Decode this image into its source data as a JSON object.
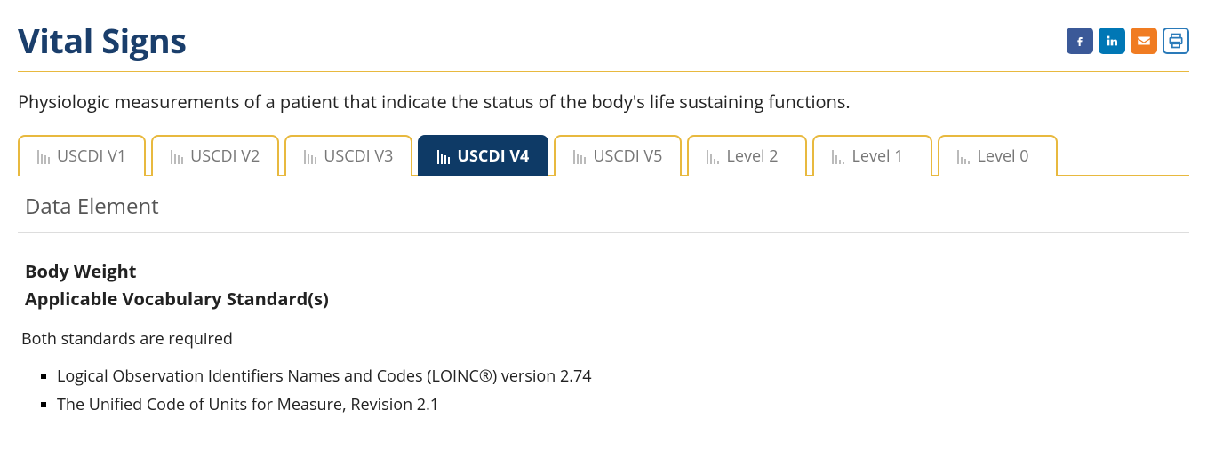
{
  "page_title": "Vital Signs",
  "description": "Physiologic measurements of a patient that indicate the status of the body's life sustaining functions.",
  "tabs": [
    {
      "label": "USCDI V1",
      "active": false,
      "opacity": [
        16,
        12,
        10,
        8
      ]
    },
    {
      "label": "USCDI V2",
      "active": false,
      "opacity": [
        16,
        12,
        10,
        8
      ]
    },
    {
      "label": "USCDI V3",
      "active": false,
      "opacity": [
        16,
        12,
        10,
        8
      ]
    },
    {
      "label": "USCDI V4",
      "active": true,
      "opacity": [
        16,
        12,
        10,
        8
      ]
    },
    {
      "label": "USCDI V5",
      "active": false,
      "opacity": [
        16,
        12,
        10,
        8
      ]
    },
    {
      "label": "Level 2",
      "active": false,
      "opacity": [
        16,
        12,
        6,
        4
      ]
    },
    {
      "label": "Level 1",
      "active": false,
      "opacity": [
        16,
        10,
        5,
        3
      ]
    },
    {
      "label": "Level 0",
      "active": false,
      "opacity": [
        16,
        8,
        6,
        4
      ]
    }
  ],
  "section_header": "Data Element",
  "element_title": "Body Weight",
  "vocab_title": "Applicable Vocabulary Standard(s)",
  "requirement_text": "Both standards are required",
  "standards": [
    "Logical Observation Identifiers Names and Codes (LOINC®) version 2.74",
    "The Unified Code of Units for Measure, Revision 2.1"
  ]
}
